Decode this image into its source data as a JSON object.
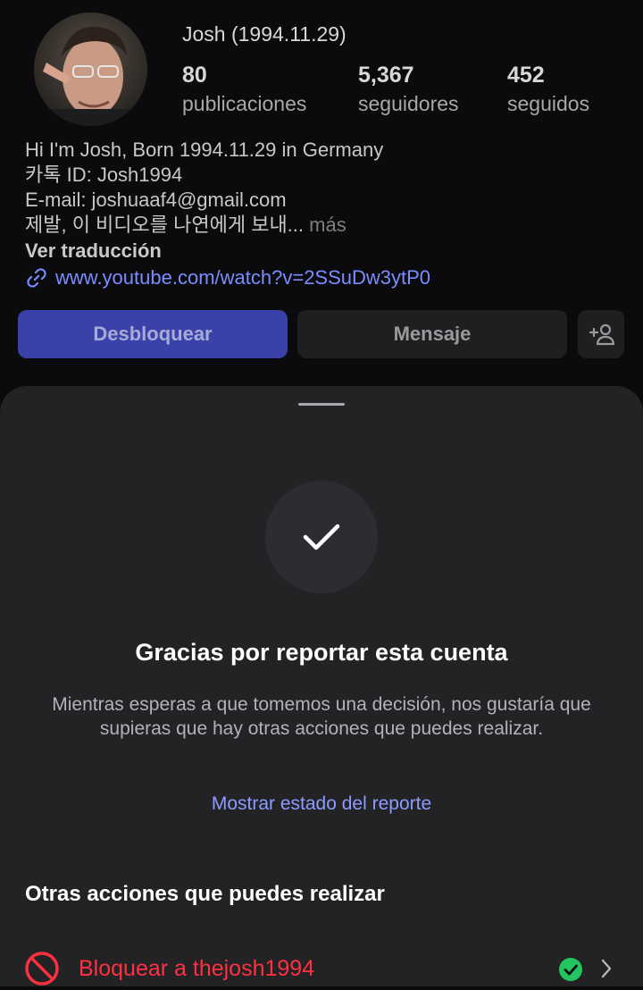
{
  "profile": {
    "name": "Josh (1994.11.29)",
    "stats": [
      {
        "value": "80",
        "label": "publicaciones"
      },
      {
        "value": "5,367",
        "label": "seguidores"
      },
      {
        "value": "452",
        "label": "seguidos"
      }
    ],
    "bio_lines": [
      "Hi I'm Josh, Born 1994.11.29 in Germany",
      "카톡 ID: Josh1994",
      "E-mail: joshuaaf4@gmail.com",
      "제발, 이 비디오를 나연에게 보내..."
    ],
    "bio_more": "más",
    "see_translation": "Ver traducción",
    "link": "www.youtube.com/watch?v=2SSuDw3ytP0",
    "buttons": {
      "unblock": "Desbloquear",
      "message": "Mensaje",
      "add_person": "+"
    }
  },
  "sheet": {
    "title": "Gracias por reportar esta cuenta",
    "description": "Mientras esperas a que tomemos una decisión, nos gustaría que supieras que hay otras acciones que puedes realizar.",
    "status_link": "Mostrar estado del reporte",
    "other_actions_title": "Otras acciones que puedes realizar",
    "actions": [
      {
        "label": "Bloquear a thejosh1994",
        "icon": "block-icon",
        "status_icon": "check-done-icon"
      }
    ]
  },
  "colors": {
    "accent": "#3a41a8",
    "link": "#8c9bff",
    "danger": "#ff3040",
    "success": "#22c55e"
  }
}
